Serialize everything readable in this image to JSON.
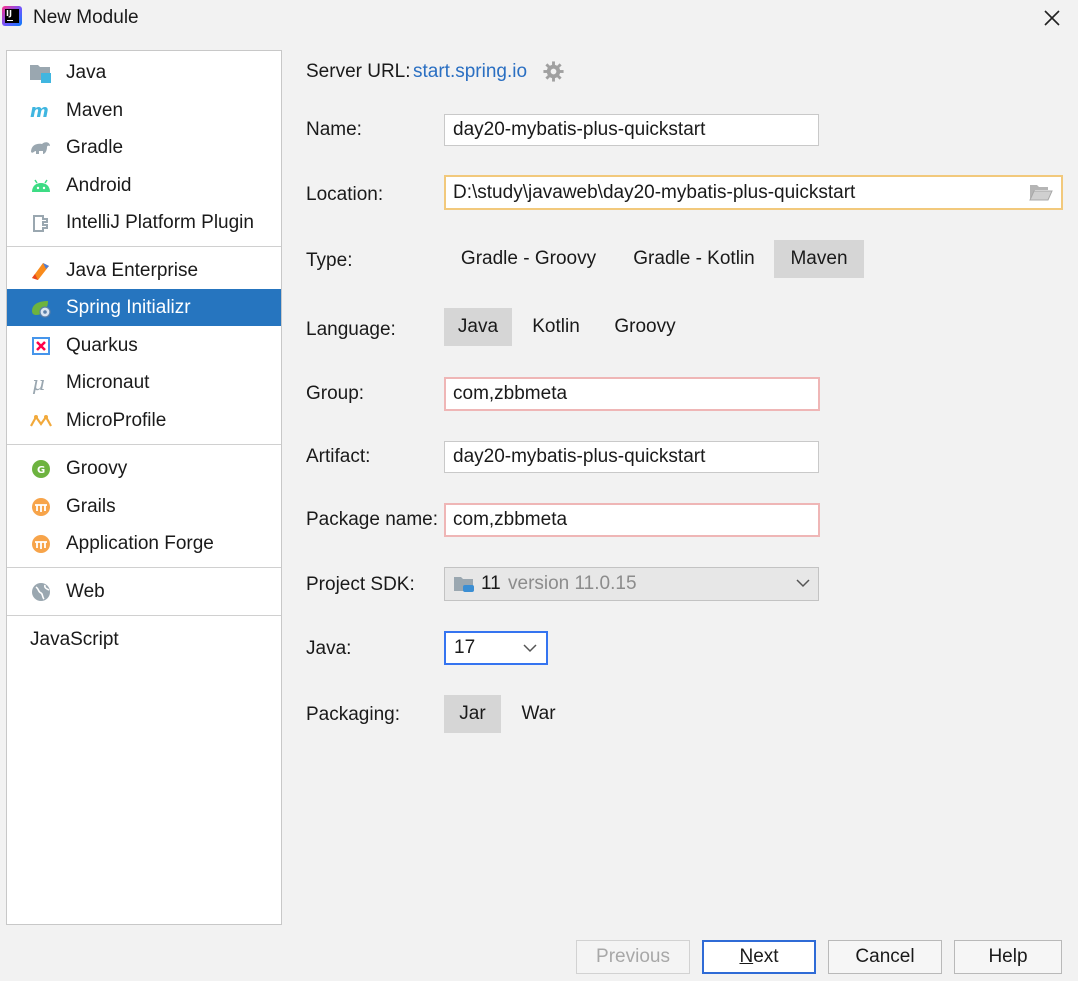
{
  "window": {
    "title": "New Module"
  },
  "sidebar": {
    "groups": [
      [
        {
          "label": "Java",
          "icon": "java-folder-icon"
        },
        {
          "label": "Maven",
          "icon": "maven-icon"
        },
        {
          "label": "Gradle",
          "icon": "gradle-icon"
        },
        {
          "label": "Android",
          "icon": "android-icon"
        },
        {
          "label": "IntelliJ Platform Plugin",
          "icon": "plugin-icon"
        }
      ],
      [
        {
          "label": "Java Enterprise",
          "icon": "java-enterprise-icon"
        },
        {
          "label": "Spring Initializr",
          "icon": "spring-icon",
          "selected": true
        },
        {
          "label": "Quarkus",
          "icon": "quarkus-icon"
        },
        {
          "label": "Micronaut",
          "icon": "micronaut-icon"
        },
        {
          "label": "MicroProfile",
          "icon": "microprofile-icon"
        }
      ],
      [
        {
          "label": "Groovy",
          "icon": "groovy-icon"
        },
        {
          "label": "Grails",
          "icon": "grails-icon"
        },
        {
          "label": "Application Forge",
          "icon": "application-forge-icon"
        }
      ],
      [
        {
          "label": "Web",
          "icon": "web-globe-icon"
        }
      ],
      [
        {
          "label": "JavaScript"
        }
      ]
    ]
  },
  "form": {
    "server_url": {
      "label": "Server URL:",
      "link": "start.spring.io"
    },
    "name": {
      "label": "Name:",
      "value": "day20-mybatis-plus-quickstart"
    },
    "location": {
      "label": "Location:",
      "value": "D:\\study\\javaweb\\day20-mybatis-plus-quickstart"
    },
    "type": {
      "label": "Type:",
      "options": [
        "Gradle - Groovy",
        "Gradle - Kotlin",
        "Maven"
      ],
      "selected": "Maven"
    },
    "language": {
      "label": "Language:",
      "options": [
        "Java",
        "Kotlin",
        "Groovy"
      ],
      "selected": "Java"
    },
    "group": {
      "label": "Group:",
      "value": "com,zbbmeta"
    },
    "artifact": {
      "label": "Artifact:",
      "value": "day20-mybatis-plus-quickstart"
    },
    "package_name": {
      "label": "Package name:",
      "value": "com,zbbmeta"
    },
    "project_sdk": {
      "label": "Project SDK:",
      "number": "11",
      "version": "version 11.0.15"
    },
    "java": {
      "label": "Java:",
      "value": "17"
    },
    "packaging": {
      "label": "Packaging:",
      "options": [
        "Jar",
        "War"
      ],
      "selected": "Jar"
    }
  },
  "buttons": {
    "previous": "Previous",
    "next_mnemonic": "N",
    "next_rest": "ext",
    "cancel": "Cancel",
    "help": "Help"
  },
  "colors": {
    "selection": "#2675bf",
    "link": "#2a6fc2",
    "validation_error_border": "#efb6b6",
    "focus_border": "#f2c97c"
  }
}
